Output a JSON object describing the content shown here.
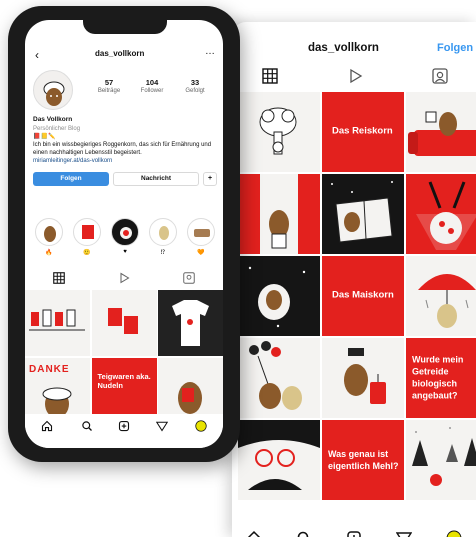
{
  "back": {
    "handle": "das_vollkorn",
    "follow_label": "Folgen",
    "tiles": [
      {
        "kind": "drawing",
        "bg": "white"
      },
      {
        "kind": "text",
        "bg": "red",
        "text": "Das Reiskorn"
      },
      {
        "kind": "drawing",
        "bg": "white"
      },
      {
        "kind": "drawing",
        "bg": "white"
      },
      {
        "kind": "drawing",
        "bg": "black"
      },
      {
        "kind": "drawing",
        "bg": "red"
      },
      {
        "kind": "drawing",
        "bg": "black"
      },
      {
        "kind": "text",
        "bg": "red",
        "text": "Das Maiskorn"
      },
      {
        "kind": "drawing",
        "bg": "white"
      },
      {
        "kind": "drawing",
        "bg": "white"
      },
      {
        "kind": "drawing",
        "bg": "white"
      },
      {
        "kind": "text",
        "bg": "red",
        "text": "Wurde mein Getreide biologisch angebaut?"
      },
      {
        "kind": "drawing",
        "bg": "black"
      },
      {
        "kind": "text",
        "bg": "red",
        "text": "Was genau ist eigentlich Mehl?"
      },
      {
        "kind": "drawing",
        "bg": "white"
      }
    ],
    "nav_icons": [
      "home-icon",
      "search-icon",
      "add-post-icon",
      "send-icon",
      "profile-avatar-icon"
    ]
  },
  "front": {
    "handle": "das_vollkorn",
    "stats": [
      {
        "num": "57",
        "label": "Beiträge"
      },
      {
        "num": "104",
        "label": "Follower"
      },
      {
        "num": "33",
        "label": "Gefolgt"
      }
    ],
    "bio": {
      "name": "Das Vollkorn",
      "category": "Persönlicher Blog",
      "emoji": "📕📒✏️",
      "text": "Ich bin ein wissbegieriges Roggenkorn, das sich für Ernährung und einen nachhaltigen Lebensstil begeistert.",
      "link": "miriamleitinger.at/das-vollkorn"
    },
    "buttons": {
      "follow": "Folgen",
      "message": "Nachricht",
      "add": "+"
    },
    "highlights": [
      {
        "sub": "🔥"
      },
      {
        "sub": "🙂"
      },
      {
        "sub": "♥"
      },
      {
        "sub": "⁉"
      },
      {
        "sub": "🧡"
      }
    ],
    "posts": [
      {
        "bg": "white",
        "text": ""
      },
      {
        "bg": "white",
        "text": ""
      },
      {
        "bg": "black",
        "text": ""
      },
      {
        "bg": "white",
        "text": "DANKE"
      },
      {
        "bg": "red",
        "text": "Teigwaren aka. Nudeln"
      },
      {
        "bg": "white",
        "text": ""
      }
    ]
  },
  "colors": {
    "brand_red": "#e3211e",
    "link_blue": "#3897f0",
    "button_blue": "#3a8de0"
  }
}
